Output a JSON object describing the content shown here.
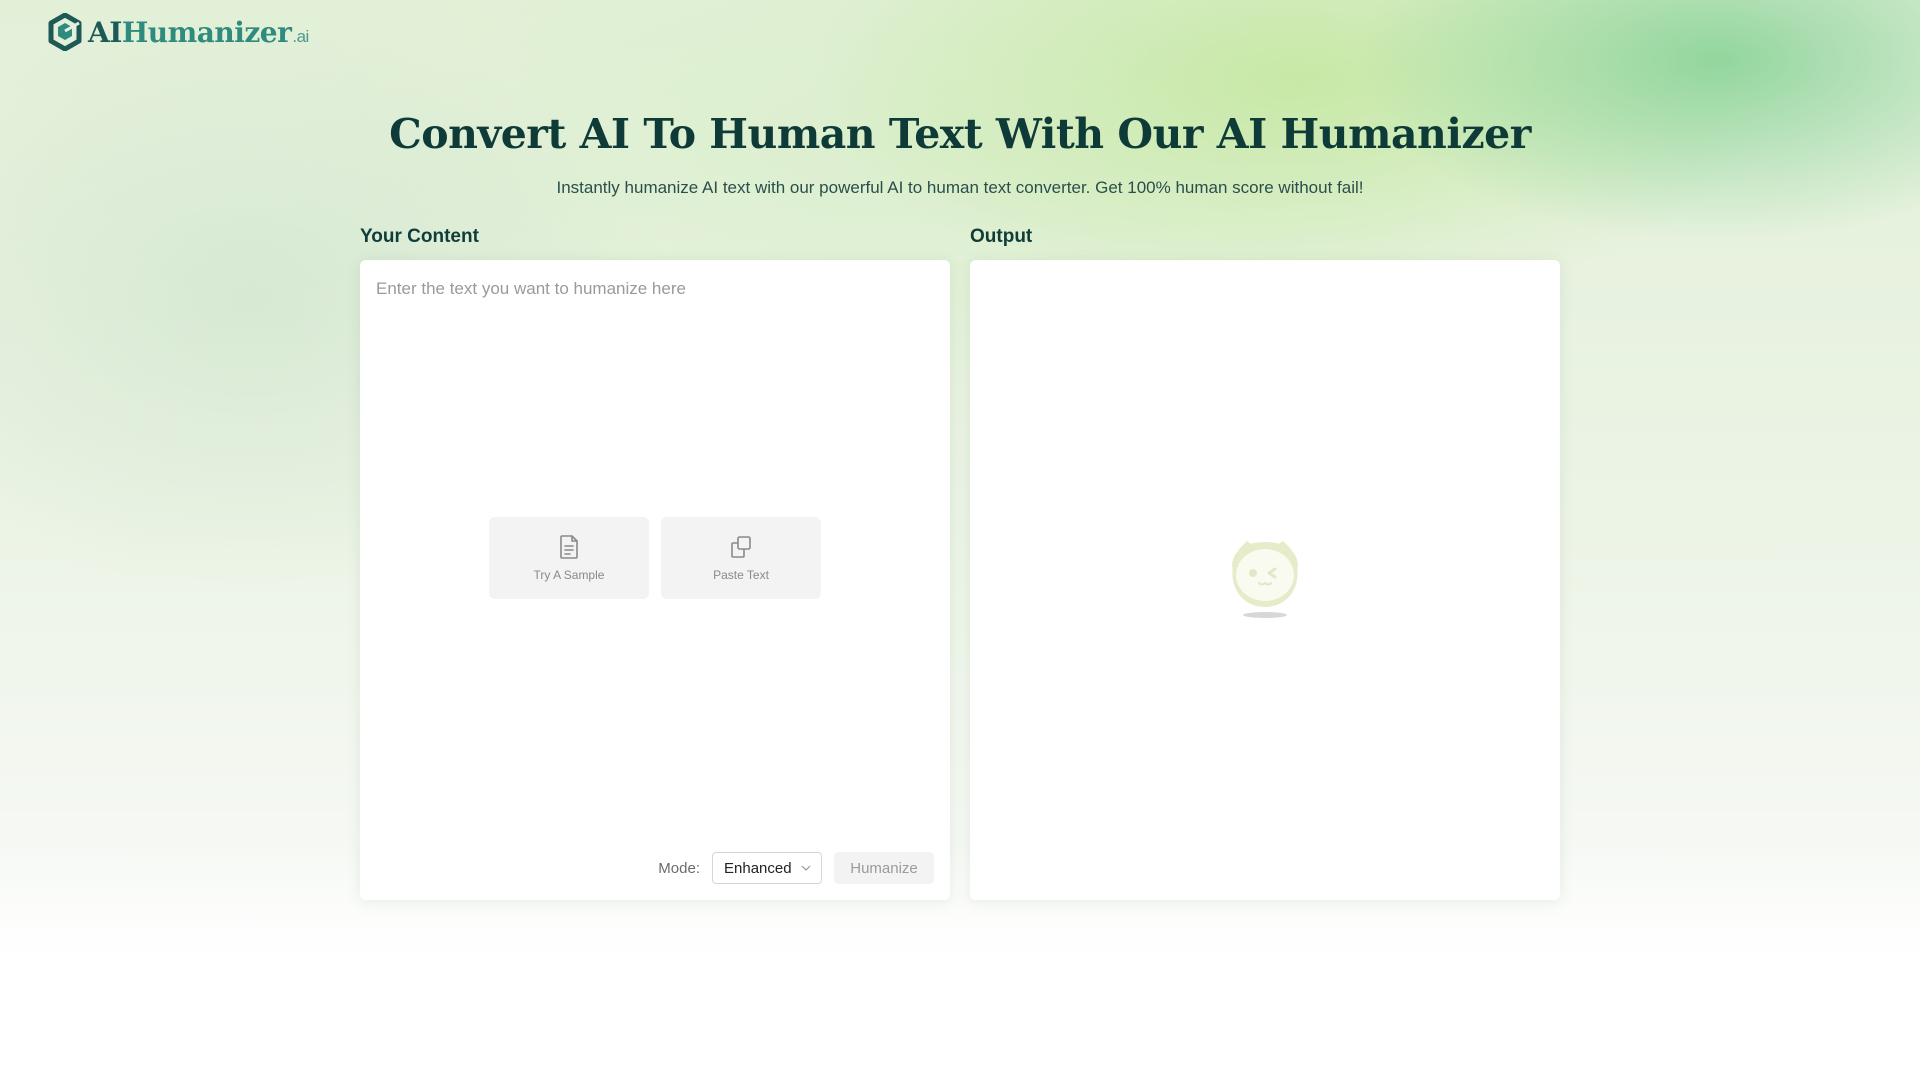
{
  "brand": {
    "name_part1": "AI",
    "name_part2": "Humanizer",
    "suffix": ".ai",
    "logo_icon": "hexagon-logo-icon",
    "colors": {
      "primary": "#0e3b38",
      "accent": "#2e8b7e"
    }
  },
  "hero": {
    "title": "Convert AI To Human Text With Our AI Humanizer",
    "subtitle": "Instantly humanize AI text with our powerful AI to human text converter. Get 100% human score without fail!"
  },
  "input_panel": {
    "label": "Your Content",
    "placeholder": "Enter the text you want to humanize here",
    "value": "",
    "quick_actions": [
      {
        "label": "Try A Sample",
        "icon": "document-icon"
      },
      {
        "label": "Paste Text",
        "icon": "copy-icon"
      }
    ],
    "mode_label": "Mode:",
    "mode_value": "Enhanced",
    "humanize_label": "Humanize"
  },
  "output_panel": {
    "label": "Output",
    "empty_icon": "mascot-icon"
  }
}
